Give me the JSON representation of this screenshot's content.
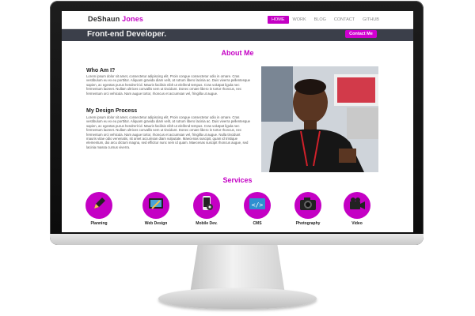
{
  "header": {
    "logo_first": "DeShaun",
    "logo_last": "Jones",
    "tagline": "Front-end Developer.",
    "contact_button": "Contact Me",
    "nav": [
      "HOME",
      "WORK",
      "BLOG",
      "CONTACT",
      "GITHUB"
    ],
    "active_nav": "HOME"
  },
  "about": {
    "title": "About Me",
    "who_heading": "Who Am I?",
    "who_text": "Lorem ipsum dolor sit amet, consectetur adipiscing elit. Proin congue consectetur odio in ornare. Cras vestibulum eu ex eu porttitor. Aliquam gravida diam velit, at rutrum libero lacinia ac. Duis viverra pellentesque sapien, ac egestas purus hendrerit id. Mauris facilisis nibh ut eleifend tempus. Cras volutpat ligula nec fermentum laoreet. Nullam ultrices convallis sem ut tincidunt. Donec ornare libero in tortor rhoncus, nec fermentum orci vehicula. Nam augue tortor, rhoncus et accumsan vel, fringilla ut augue.",
    "design_heading": "My Design Process",
    "design_text": "Lorem ipsum dolor sit amet, consectetur adipiscing elit. Proin congue consectetur odio in ornare. Cras vestibulum eu ex eu porttitor. Aliquam gravida diam velit, at rutrum libero lacinia ac. Duis viverra pellentesque sapien, ac egestas purus hendrerit id. Mauris facilisis nibh ut eleifend tempus. Cras volutpat ligula nec fermentum laoreet. Nullam ultrices convallis sem ut tincidunt. Donec ornare libero in tortor rhoncus, nec fermentum orci vehicula. Nam augue tortor, rhoncus et accumsan vel, fringilla ut augue. Nulla tincidunt mauris vitae odio venenatis, sit amet accumsan diam vulputate. Maecenas suscipit, quam id tristique elementum, dui arcu dictum magna, sed efficitur nunc sem id quam. Maecenas suscipit rhoncus augue, sed lacinia massa cursus viverra."
  },
  "services": {
    "title": "Services",
    "items": [
      {
        "label": "Planning",
        "icon": "pencil-icon"
      },
      {
        "label": "Web Design",
        "icon": "tablet-icon"
      },
      {
        "label": "Mobile Dev.",
        "icon": "mobile-icon"
      },
      {
        "label": "CMS",
        "icon": "code-icon"
      },
      {
        "label": "Photography",
        "icon": "camera-icon"
      },
      {
        "label": "Video",
        "icon": "video-camera-icon"
      }
    ]
  },
  "colors": {
    "accent": "#c400c4",
    "header_bg": "#3b3f4a"
  }
}
